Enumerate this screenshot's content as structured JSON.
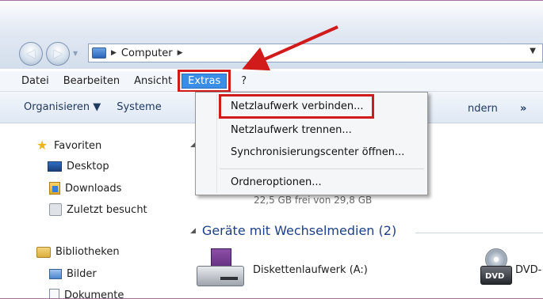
{
  "address": {
    "location": "Computer"
  },
  "menubar": {
    "items": [
      "Datei",
      "Bearbeiten",
      "Ansicht",
      "Extras",
      "?"
    ]
  },
  "command_bar": {
    "organize": "Organisieren ▼",
    "system_partial": "Systeme",
    "right_partial": "ndern",
    "more": "»"
  },
  "extras_menu": {
    "items": [
      "Netzlaufwerk verbinden...",
      "Netzlaufwerk trennen...",
      "Synchronisierungscenter öffnen...",
      "Ordneroptionen..."
    ]
  },
  "sidebar": {
    "favorites_header": "Favoriten",
    "favorites": [
      "Desktop",
      "Downloads",
      "Zuletzt besucht"
    ],
    "libraries_header": "Bibliotheken",
    "libraries": [
      "Bilder",
      "Dokumente"
    ]
  },
  "content": {
    "drive_free_text": "22,5 GB frei von 29,8 GB",
    "removable_group": "Geräte mit Wechselmedien (2)",
    "floppy_label": "Diskettenlaufwerk (A:)",
    "dvd_label": "DVD-",
    "dvd_badge": "DVD"
  },
  "colors": {
    "accent": "#3a8ee8",
    "annotation": "#d11a1a",
    "group_header": "#1e3f87"
  }
}
